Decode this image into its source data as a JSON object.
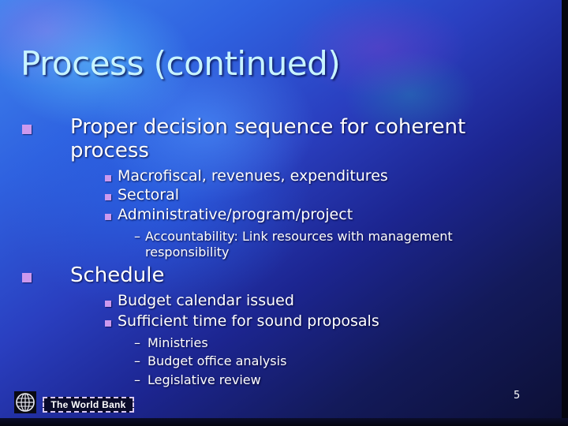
{
  "slide": {
    "title": "Process (continued)",
    "bullets": [
      {
        "text_line1": "Proper decision sequence for coherent",
        "text_line2": "process",
        "sub": [
          {
            "text": "Macrofiscal, revenues, expenditures"
          },
          {
            "text": "Sectoral"
          },
          {
            "text": "Administrative/program/project",
            "sub": [
              {
                "text_line1": "Accountability: Link resources with management",
                "text_line2": "responsibility"
              }
            ]
          }
        ]
      },
      {
        "text": "Schedule",
        "sub": [
          {
            "text": "Budget calendar issued"
          },
          {
            "text": "Sufficient time for sound proposals",
            "sub": [
              {
                "text": "Ministries"
              },
              {
                "text": "Budget office analysis"
              },
              {
                "text": "Legislative review"
              }
            ]
          }
        ]
      }
    ],
    "dash_glyph": "–"
  },
  "footer": {
    "logo_icon": "globe-icon",
    "brand_label": "The World Bank",
    "page_number": "5"
  },
  "colors": {
    "title": "#c8f4ff",
    "bullet": "#cc99ee",
    "text": "#ffffff"
  }
}
